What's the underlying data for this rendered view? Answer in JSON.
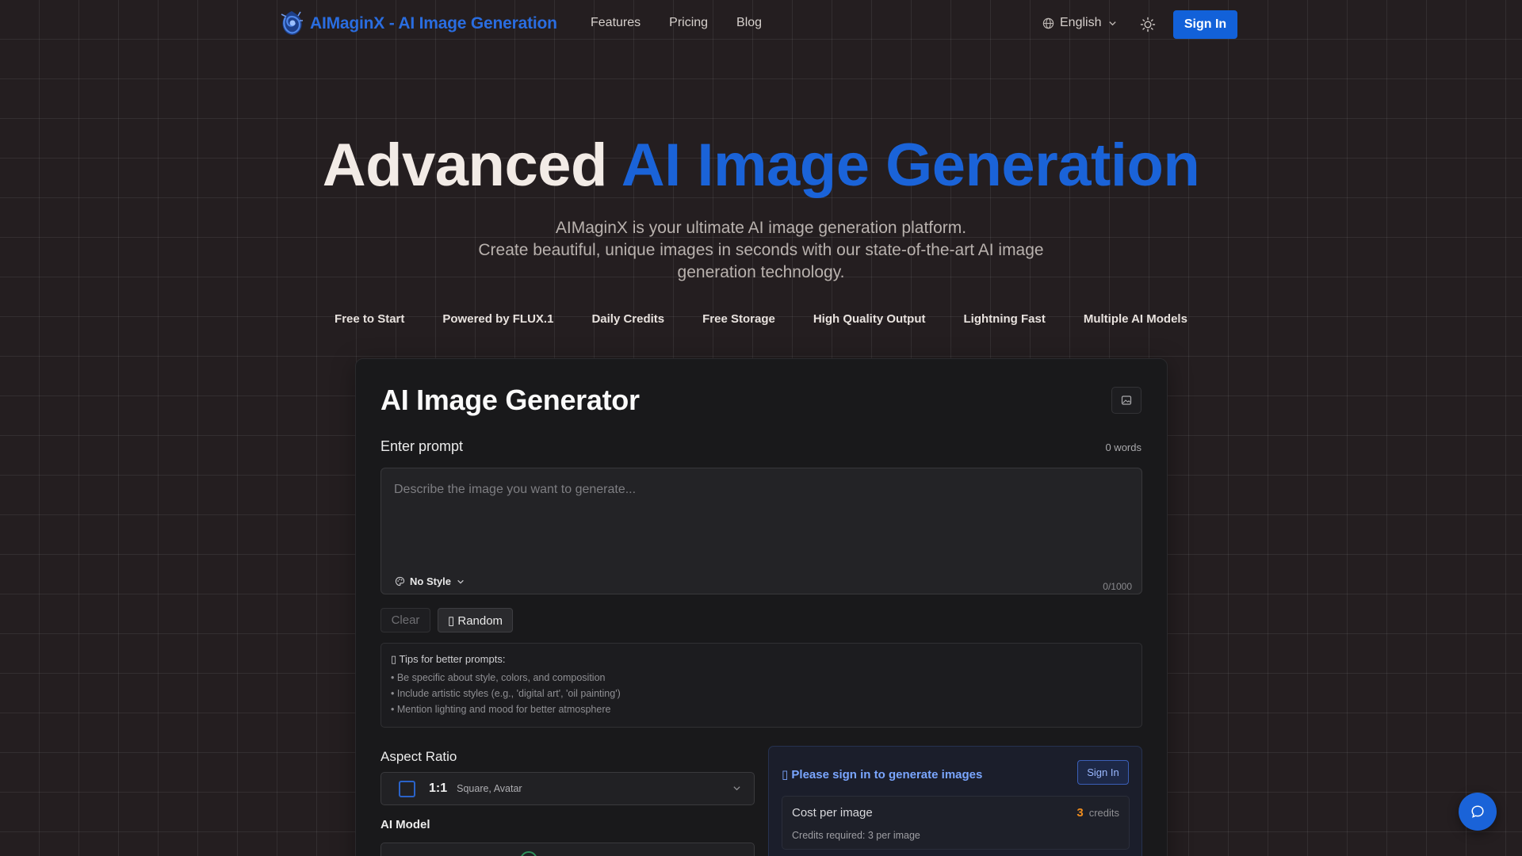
{
  "nav": {
    "brand": "AIMaginX - AI Image Generation",
    "links": [
      "Features",
      "Pricing",
      "Blog"
    ],
    "language": "English",
    "sign_in": "Sign In"
  },
  "hero": {
    "title_plain": "Advanced ",
    "title_accent": "AI Image Generation",
    "subtitle_line1": "AIMaginX is your ultimate AI image generation platform.",
    "subtitle_line2": "Create beautiful, unique images in seconds with our state-of-the-art AI image generation technology.",
    "features": [
      "Free to Start",
      "Powered by FLUX.1",
      "Daily Credits",
      "Free Storage",
      "High Quality Output",
      "Lightning Fast",
      "Multiple AI Models"
    ]
  },
  "generator": {
    "title": "AI Image Generator",
    "prompt_label": "Enter prompt",
    "word_count": "0 words",
    "prompt_placeholder": "Describe the image you want to generate...",
    "style": "No Style",
    "char_count": "0/1000",
    "clear": "Clear",
    "random": "▯ Random",
    "tips": {
      "title": "▯ Tips for better prompts:",
      "items": [
        "• Be specific about style, colors, and composition",
        "• Include artistic styles (e.g., 'digital art', 'oil painting')",
        "• Mention lighting and mood for better atmosphere"
      ]
    },
    "aspect_label": "Aspect Ratio",
    "aspect_ratio": "1:1",
    "aspect_desc": "Square, Avatar",
    "model_label": "AI Model"
  },
  "signin_panel": {
    "message": "▯ Please sign in to generate images",
    "button": "Sign In",
    "cost_label": "Cost per image",
    "cost_value": "3",
    "cost_unit": "credits",
    "cost_sub": "Credits required: 3 per image"
  },
  "colors": {
    "accent": "#1a63d8",
    "background": "#241e20",
    "credits": "#f08d1e"
  },
  "icons": [
    "logo-icon",
    "globe-icon",
    "chevron-down-icon",
    "sun-icon",
    "image-icon",
    "palette-icon",
    "chat-icon"
  ]
}
